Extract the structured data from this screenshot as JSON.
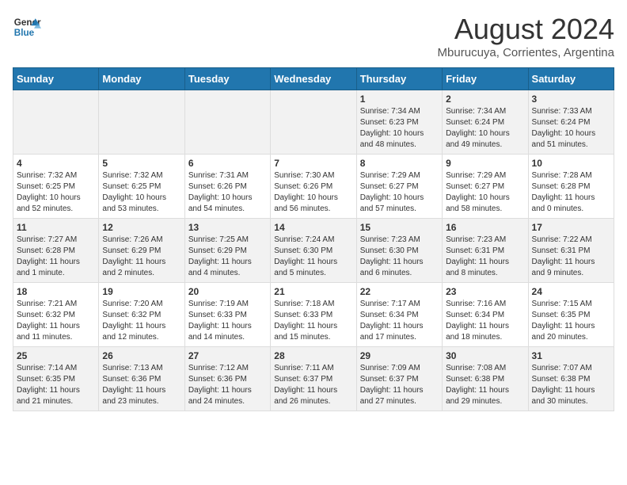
{
  "logo": {
    "line1": "General",
    "line2": "Blue"
  },
  "title": "August 2024",
  "subtitle": "Mburucuya, Corrientes, Argentina",
  "weekdays": [
    "Sunday",
    "Monday",
    "Tuesday",
    "Wednesday",
    "Thursday",
    "Friday",
    "Saturday"
  ],
  "weeks": [
    [
      {
        "day": "",
        "info": ""
      },
      {
        "day": "",
        "info": ""
      },
      {
        "day": "",
        "info": ""
      },
      {
        "day": "",
        "info": ""
      },
      {
        "day": "1",
        "info": "Sunrise: 7:34 AM\nSunset: 6:23 PM\nDaylight: 10 hours\nand 48 minutes."
      },
      {
        "day": "2",
        "info": "Sunrise: 7:34 AM\nSunset: 6:24 PM\nDaylight: 10 hours\nand 49 minutes."
      },
      {
        "day": "3",
        "info": "Sunrise: 7:33 AM\nSunset: 6:24 PM\nDaylight: 10 hours\nand 51 minutes."
      }
    ],
    [
      {
        "day": "4",
        "info": "Sunrise: 7:32 AM\nSunset: 6:25 PM\nDaylight: 10 hours\nand 52 minutes."
      },
      {
        "day": "5",
        "info": "Sunrise: 7:32 AM\nSunset: 6:25 PM\nDaylight: 10 hours\nand 53 minutes."
      },
      {
        "day": "6",
        "info": "Sunrise: 7:31 AM\nSunset: 6:26 PM\nDaylight: 10 hours\nand 54 minutes."
      },
      {
        "day": "7",
        "info": "Sunrise: 7:30 AM\nSunset: 6:26 PM\nDaylight: 10 hours\nand 56 minutes."
      },
      {
        "day": "8",
        "info": "Sunrise: 7:29 AM\nSunset: 6:27 PM\nDaylight: 10 hours\nand 57 minutes."
      },
      {
        "day": "9",
        "info": "Sunrise: 7:29 AM\nSunset: 6:27 PM\nDaylight: 10 hours\nand 58 minutes."
      },
      {
        "day": "10",
        "info": "Sunrise: 7:28 AM\nSunset: 6:28 PM\nDaylight: 11 hours\nand 0 minutes."
      }
    ],
    [
      {
        "day": "11",
        "info": "Sunrise: 7:27 AM\nSunset: 6:28 PM\nDaylight: 11 hours\nand 1 minute."
      },
      {
        "day": "12",
        "info": "Sunrise: 7:26 AM\nSunset: 6:29 PM\nDaylight: 11 hours\nand 2 minutes."
      },
      {
        "day": "13",
        "info": "Sunrise: 7:25 AM\nSunset: 6:29 PM\nDaylight: 11 hours\nand 4 minutes."
      },
      {
        "day": "14",
        "info": "Sunrise: 7:24 AM\nSunset: 6:30 PM\nDaylight: 11 hours\nand 5 minutes."
      },
      {
        "day": "15",
        "info": "Sunrise: 7:23 AM\nSunset: 6:30 PM\nDaylight: 11 hours\nand 6 minutes."
      },
      {
        "day": "16",
        "info": "Sunrise: 7:23 AM\nSunset: 6:31 PM\nDaylight: 11 hours\nand 8 minutes."
      },
      {
        "day": "17",
        "info": "Sunrise: 7:22 AM\nSunset: 6:31 PM\nDaylight: 11 hours\nand 9 minutes."
      }
    ],
    [
      {
        "day": "18",
        "info": "Sunrise: 7:21 AM\nSunset: 6:32 PM\nDaylight: 11 hours\nand 11 minutes."
      },
      {
        "day": "19",
        "info": "Sunrise: 7:20 AM\nSunset: 6:32 PM\nDaylight: 11 hours\nand 12 minutes."
      },
      {
        "day": "20",
        "info": "Sunrise: 7:19 AM\nSunset: 6:33 PM\nDaylight: 11 hours\nand 14 minutes."
      },
      {
        "day": "21",
        "info": "Sunrise: 7:18 AM\nSunset: 6:33 PM\nDaylight: 11 hours\nand 15 minutes."
      },
      {
        "day": "22",
        "info": "Sunrise: 7:17 AM\nSunset: 6:34 PM\nDaylight: 11 hours\nand 17 minutes."
      },
      {
        "day": "23",
        "info": "Sunrise: 7:16 AM\nSunset: 6:34 PM\nDaylight: 11 hours\nand 18 minutes."
      },
      {
        "day": "24",
        "info": "Sunrise: 7:15 AM\nSunset: 6:35 PM\nDaylight: 11 hours\nand 20 minutes."
      }
    ],
    [
      {
        "day": "25",
        "info": "Sunrise: 7:14 AM\nSunset: 6:35 PM\nDaylight: 11 hours\nand 21 minutes."
      },
      {
        "day": "26",
        "info": "Sunrise: 7:13 AM\nSunset: 6:36 PM\nDaylight: 11 hours\nand 23 minutes."
      },
      {
        "day": "27",
        "info": "Sunrise: 7:12 AM\nSunset: 6:36 PM\nDaylight: 11 hours\nand 24 minutes."
      },
      {
        "day": "28",
        "info": "Sunrise: 7:11 AM\nSunset: 6:37 PM\nDaylight: 11 hours\nand 26 minutes."
      },
      {
        "day": "29",
        "info": "Sunrise: 7:09 AM\nSunset: 6:37 PM\nDaylight: 11 hours\nand 27 minutes."
      },
      {
        "day": "30",
        "info": "Sunrise: 7:08 AM\nSunset: 6:38 PM\nDaylight: 11 hours\nand 29 minutes."
      },
      {
        "day": "31",
        "info": "Sunrise: 7:07 AM\nSunset: 6:38 PM\nDaylight: 11 hours\nand 30 minutes."
      }
    ]
  ]
}
